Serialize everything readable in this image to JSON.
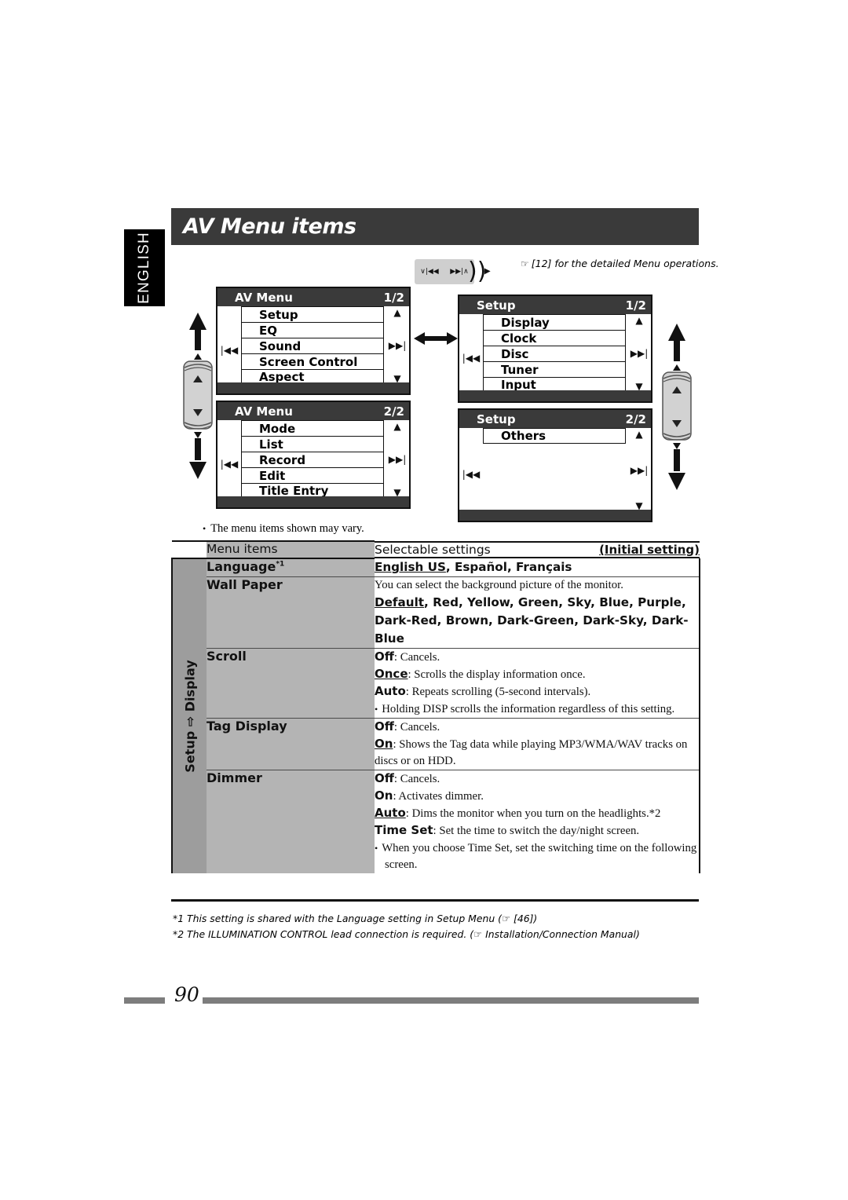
{
  "page": {
    "language_tab": "ENGLISH",
    "title": "AV Menu items",
    "page_number": "90",
    "top_note": "[12] for the detailed Menu operations.",
    "hand_icon": "☞",
    "menu_vary_note": "The menu items shown may vary."
  },
  "rocker_horizontal": {
    "left_label": "∨|◀◀",
    "right_label": "▶▶|∧",
    "left_arrow": "◀",
    "right_arrow": "▶"
  },
  "screens": [
    {
      "id": "av-menu-1",
      "title": "AV Menu",
      "page_indicator": "1/2",
      "prev_icon": "|◀◀",
      "next_icon": "▶▶|",
      "up_icon": "▲",
      "down_icon": "▼",
      "items": [
        "Setup",
        "EQ",
        "Sound",
        "Screen Control",
        "Aspect"
      ]
    },
    {
      "id": "av-menu-2",
      "title": "AV Menu",
      "page_indicator": "2/2",
      "prev_icon": "|◀◀",
      "next_icon": "▶▶|",
      "up_icon": "▲",
      "down_icon": "▼",
      "items": [
        "Mode",
        "List",
        "Record",
        "Edit",
        "Title Entry"
      ]
    },
    {
      "id": "setup-1",
      "title": "Setup",
      "page_indicator": "1/2",
      "prev_icon": "|◀◀",
      "next_icon": "▶▶|",
      "up_icon": "▲",
      "down_icon": "▼",
      "items": [
        "Display",
        "Clock",
        "Disc",
        "Tuner",
        "Input"
      ]
    },
    {
      "id": "setup-2",
      "title": "Setup",
      "page_indicator": "2/2",
      "prev_icon": "|◀◀",
      "next_icon": "▶▶|",
      "up_icon": "▲",
      "down_icon": "▼",
      "items": [
        "Others"
      ]
    }
  ],
  "transition_arrow": "◀▶",
  "table": {
    "header": {
      "menu_items": "Menu items",
      "selectable_settings": "Selectable settings",
      "initial_setting": "(Initial setting)"
    },
    "group_label": "Setup ⇨ Display",
    "rows": [
      {
        "name": "Language",
        "footnote_marker": "*1",
        "options_line": "English US, Español, Français",
        "options": [
          {
            "text": "English US",
            "initial": true
          },
          {
            "text": "Español",
            "initial": false
          },
          {
            "text": "Français",
            "initial": false
          }
        ]
      },
      {
        "name": "Wall Paper",
        "footnote_marker": "",
        "description": "You can select the background picture of the monitor.",
        "options_line": "Default, Red, Yellow, Green, Sky, Blue, Purple, Dark-Red, Brown, Dark-Green, Dark-Sky, Dark-Blue",
        "options": [
          {
            "text": "Default",
            "initial": true
          },
          {
            "text": "Red",
            "initial": false
          },
          {
            "text": "Yellow",
            "initial": false
          },
          {
            "text": "Green",
            "initial": false
          },
          {
            "text": "Sky",
            "initial": false
          },
          {
            "text": "Blue",
            "initial": false
          },
          {
            "text": "Purple",
            "initial": false
          },
          {
            "text": "Dark-Red",
            "initial": false
          },
          {
            "text": "Brown",
            "initial": false
          },
          {
            "text": "Dark-Green",
            "initial": false
          },
          {
            "text": "Dark-Sky",
            "initial": false
          },
          {
            "text": "Dark-Blue",
            "initial": false
          }
        ]
      },
      {
        "name": "Scroll",
        "footnote_marker": "",
        "settings": [
          {
            "label": "Off",
            "initial": false,
            "desc": ": Cancels."
          },
          {
            "label": "Once",
            "initial": true,
            "desc": ": Scrolls the display information once."
          },
          {
            "label": "Auto",
            "initial": false,
            "desc": ": Repeats scrolling (5-second intervals)."
          }
        ],
        "note": "Holding DISP scrolls the information regardless of this setting."
      },
      {
        "name": "Tag Display",
        "footnote_marker": "",
        "settings": [
          {
            "label": "Off",
            "initial": false,
            "desc": ": Cancels."
          },
          {
            "label": "On",
            "initial": true,
            "desc": ": Shows the Tag data while playing MP3/WMA/WAV tracks on discs or on HDD."
          }
        ]
      },
      {
        "name": "Dimmer",
        "footnote_marker": "",
        "settings": [
          {
            "label": "Off",
            "initial": false,
            "desc": ": Cancels."
          },
          {
            "label": "On",
            "initial": false,
            "desc": ": Activates dimmer."
          },
          {
            "label": "Auto",
            "initial": true,
            "desc": ": Dims the monitor when you turn on the headlights.*2"
          },
          {
            "label": "Time Set",
            "initial": false,
            "desc": ": Set the time to switch the day/night screen."
          }
        ],
        "note": "When you choose Time Set, set the switching time on the following screen."
      }
    ]
  },
  "footnotes": [
    "*1 This setting is shared with the Language setting in Setup Menu (☞ [46])",
    "*2 The ILLUMINATION CONTROL lead connection is required. (☞ Installation/Connection Manual)"
  ],
  "colors": {
    "header_dark": "#3a3a3a",
    "table_header_gray": "#b4b4b4",
    "side_gray": "#9d9d9d",
    "rule": "#111111",
    "footer_bar": "#7d7d7d"
  }
}
